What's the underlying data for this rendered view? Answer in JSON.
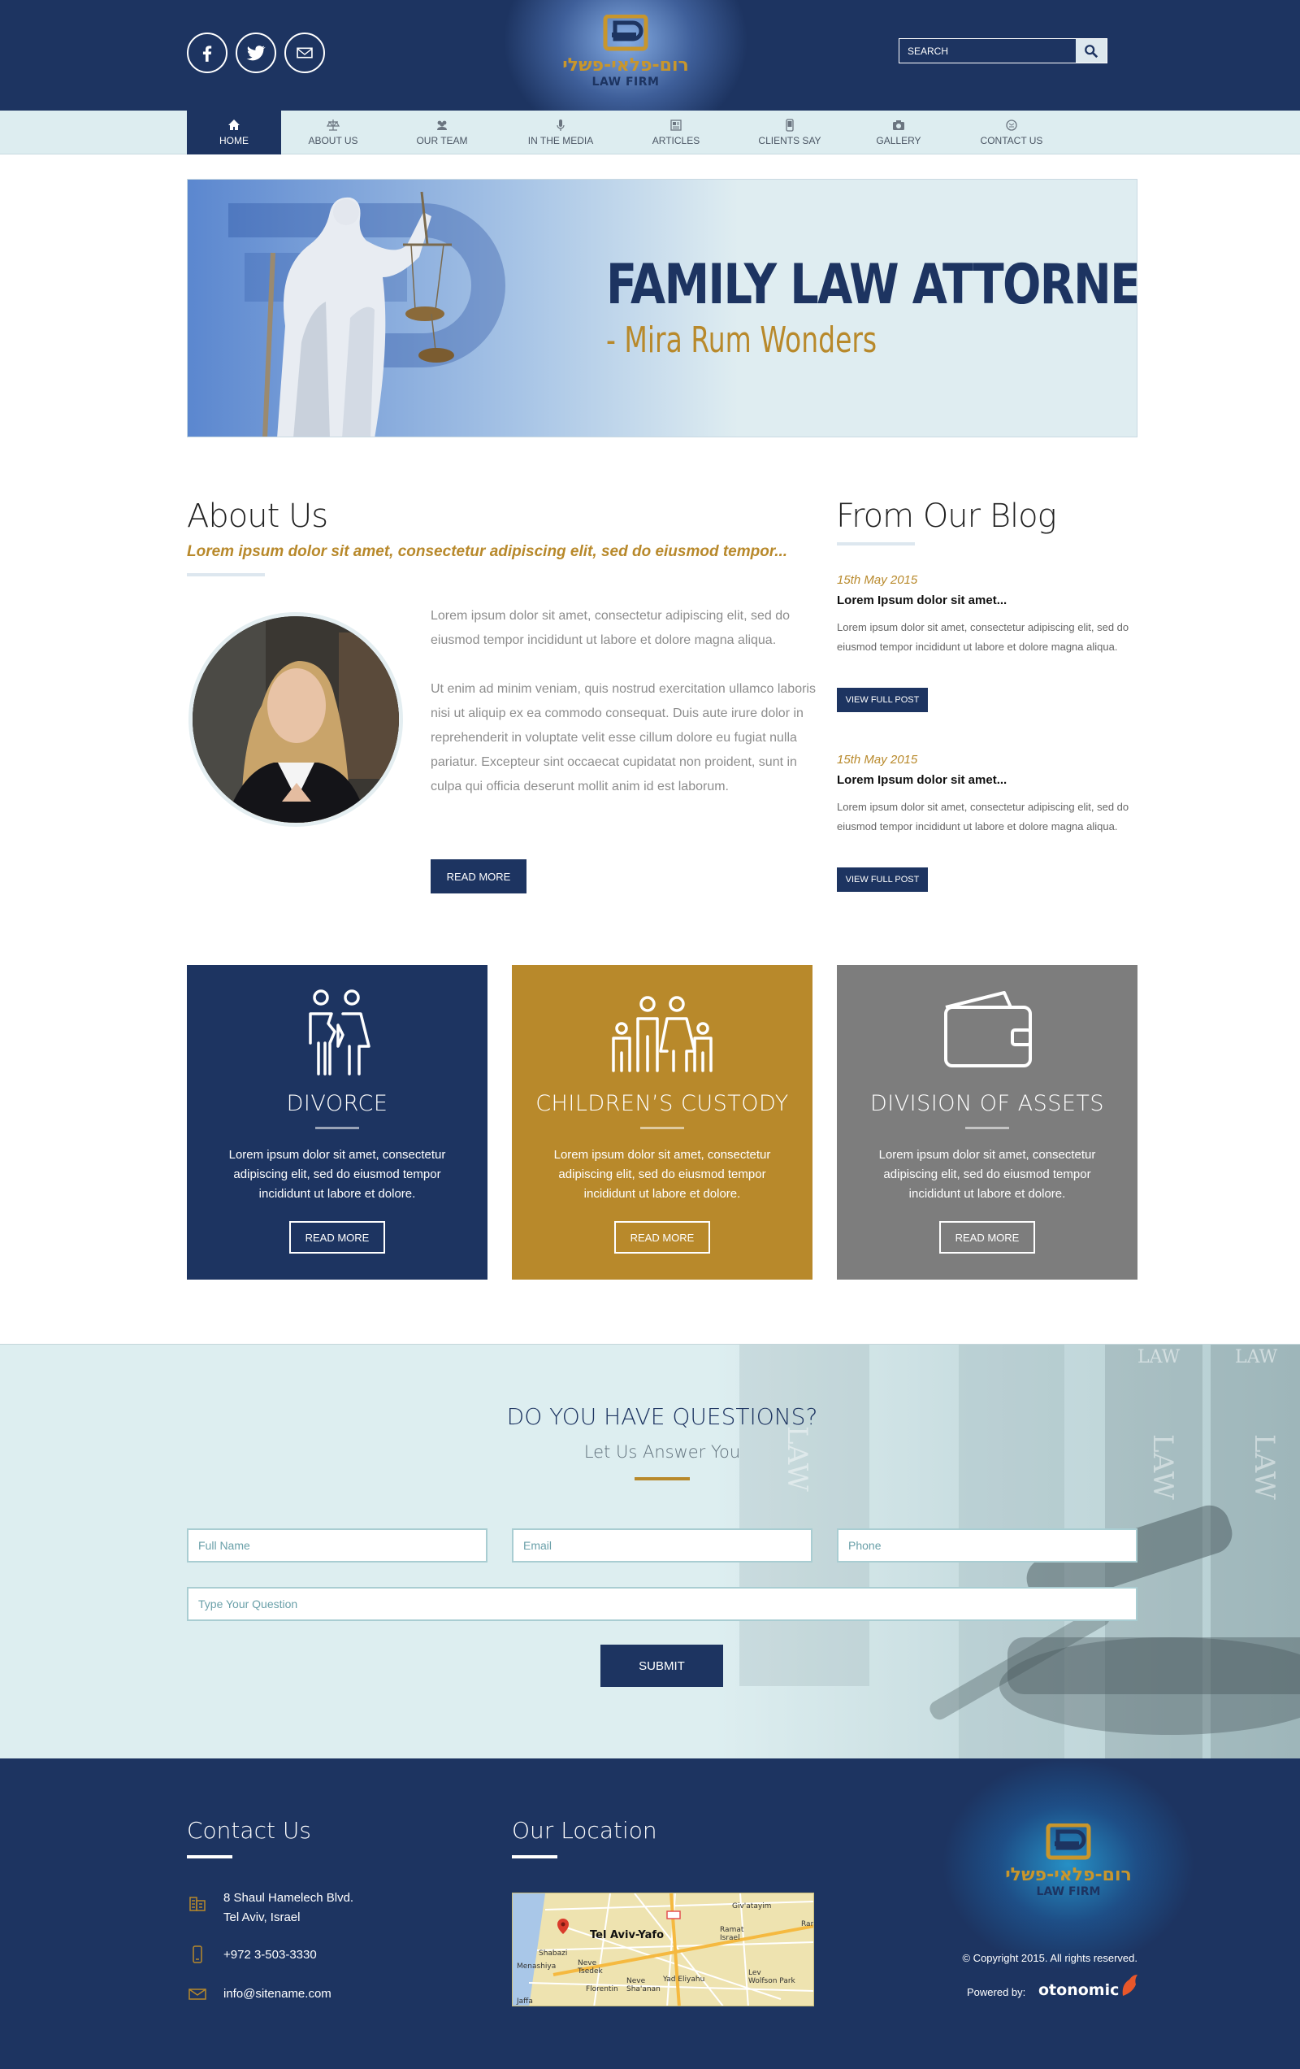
{
  "header": {
    "logo": {
      "hebrew": "רום-פלאי-פשלי",
      "sub": "LAW FIRM"
    },
    "search_placeholder": "SEARCH",
    "social": [
      "facebook-icon",
      "twitter-icon",
      "email-icon"
    ]
  },
  "nav": {
    "items": [
      {
        "label": "HOME",
        "icon": "home-icon"
      },
      {
        "label": "ABOUT US",
        "icon": "scales-icon"
      },
      {
        "label": "OUR TEAM",
        "icon": "team-icon"
      },
      {
        "label": "IN THE MEDIA",
        "icon": "microphone-icon"
      },
      {
        "label": "ARTICLES",
        "icon": "article-icon"
      },
      {
        "label": "CLIENTS SAY",
        "icon": "phone-icon"
      },
      {
        "label": "GALLERY",
        "icon": "camera-icon"
      },
      {
        "label": "CONTACT US",
        "icon": "contact-icon"
      }
    ]
  },
  "hero": {
    "title": "FAMILY LAW ATTORNEY",
    "subtitle": "- Mira Rum Wonders"
  },
  "about": {
    "title": "About Us",
    "tagline": "Lorem ipsum dolor sit amet, consectetur adipiscing elit, sed do eiusmod tempor...",
    "para1": "Lorem ipsum dolor sit amet, consectetur adipiscing elit, sed do eiusmod tempor incididunt ut labore et dolore magna aliqua.",
    "para2": "Ut enim ad minim veniam, quis nostrud exercitation ullamco laboris nisi ut aliquip ex ea commodo consequat. Duis aute irure dolor in reprehenderit in voluptate velit esse cillum dolore eu fugiat nulla pariatur. Excepteur sint occaecat cupidatat non proident, sunt in culpa qui officia deserunt mollit anim id est laborum.",
    "read_more": "READ MORE"
  },
  "blog": {
    "title": "From Our Blog",
    "posts": [
      {
        "date": "15th May 2015",
        "title": "Lorem Ipsum dolor sit amet...",
        "text": "Lorem ipsum dolor sit amet, consectetur adipiscing elit, sed do eiusmod tempor incididunt ut labore et dolore magna aliqua.",
        "button": "VIEW FULL POST"
      },
      {
        "date": "15th May 2015",
        "title": "Lorem Ipsum dolor sit amet...",
        "text": "Lorem ipsum dolor sit amet, consectetur adipiscing elit, sed do eiusmod tempor incididunt ut labore et dolore magna aliqua.",
        "button": "VIEW FULL POST"
      }
    ]
  },
  "services": [
    {
      "title": "DIVORCE",
      "text": "Lorem ipsum dolor sit amet, consectetur adipiscing elit, sed do eiusmod tempor incididunt ut labore et dolore.",
      "button": "READ MORE",
      "color": "#1d3461",
      "icon": "divorce-couple-icon"
    },
    {
      "title": "CHILDREN’S CUSTODY",
      "text": "Lorem ipsum dolor sit amet, consectetur adipiscing elit, sed do eiusmod tempor incididunt ut labore et dolore.",
      "button": "READ MORE",
      "color": "#b8892b",
      "icon": "family-icon"
    },
    {
      "title": "DIVISION OF ASSETS",
      "text": "Lorem ipsum dolor sit amet, consectetur adipiscing elit, sed do eiusmod tempor incididunt ut labore et dolore.",
      "button": "READ MORE",
      "color": "#7d7d7d",
      "icon": "wallet-icon"
    }
  ],
  "questions": {
    "title": "DO YOU HAVE QUESTIONS?",
    "subtitle": "Let Us Answer You",
    "fields": {
      "name": "Full Name",
      "email": "Email",
      "phone": "Phone",
      "question": "Type Your Question"
    },
    "submit": "SUBMIT",
    "bg_words": [
      "LAW",
      "LAW",
      "LAW",
      "LAW",
      "LAW"
    ]
  },
  "footer": {
    "contact_title": "Contact Us",
    "address_line1": "8 Shaul Hamelech Blvd.",
    "address_line2": "Tel Aviv, Israel",
    "phone": "+972 3-503-3330",
    "email": "info@sitename.com",
    "location_title": "Our Location",
    "map_labels": {
      "city": "Tel Aviv-Yafo",
      "givatayim": "Giv'atayim",
      "ramat": "Ramat",
      "israel": "Israel",
      "shabazi": "Shabazi",
      "menashiya": "Menashiya",
      "neve_tsedek": "Neve",
      "tsedek": "Tsedek",
      "florentin": "Florentin",
      "shalanan": "Sha'anan",
      "neve2": "Neve",
      "yad_eliyahu": "Yad Eliyahu",
      "lev": "Lev",
      "wolfson_park": "Wolfson Park",
      "jaffa": "Jaffa",
      "ran": "Ran"
    },
    "logo": {
      "hebrew": "רום-פלאי-פשלי",
      "sub": "LAW FIRM"
    },
    "copyright": "© Copyright 2015. All rights reserved.",
    "powered_by": "Powered by:",
    "powered_brand": "otonomic"
  }
}
